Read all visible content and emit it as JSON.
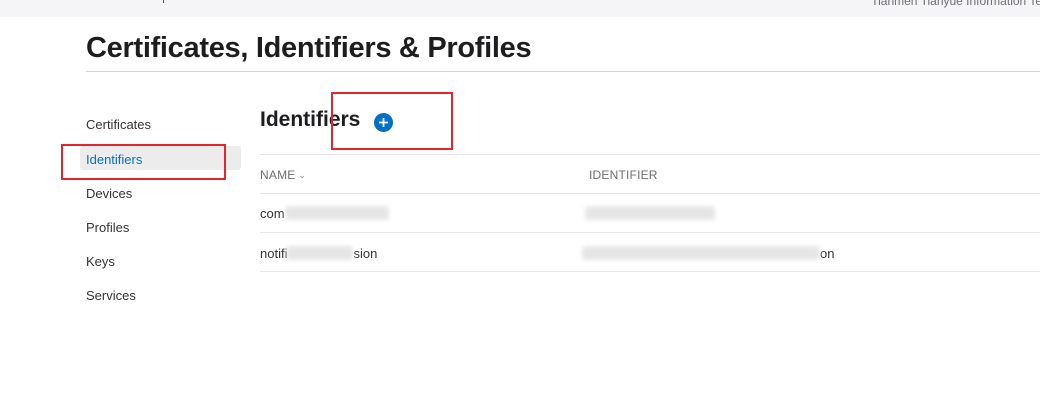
{
  "topbar": {
    "team_name": "Tianmen Tianyue Information Tec"
  },
  "page": {
    "title": "Certificates, Identifiers & Profiles"
  },
  "sidebar": {
    "items": [
      {
        "label": "Certificates",
        "active": false
      },
      {
        "label": "Identifiers",
        "active": true
      },
      {
        "label": "Devices",
        "active": false
      },
      {
        "label": "Profiles",
        "active": false
      },
      {
        "label": "Keys",
        "active": false
      },
      {
        "label": "Services",
        "active": false
      }
    ]
  },
  "main": {
    "section_title": "Identifiers",
    "add_button_symbol": "+",
    "table": {
      "columns": {
        "name": "NAME",
        "identifier": "IDENTIFIER"
      },
      "sort_icon": "chevron-down-icon",
      "rows": [
        {
          "name_visible_start": "com",
          "name_visible_end": "",
          "identifier_visible_end": ""
        },
        {
          "name_visible_start": "notifi",
          "name_visible_end": "sion",
          "identifier_visible_end": "on"
        }
      ]
    }
  },
  "colors": {
    "accent": "#0070c9",
    "annotation_red": "#e3262b",
    "active_bg": "#ececec"
  }
}
